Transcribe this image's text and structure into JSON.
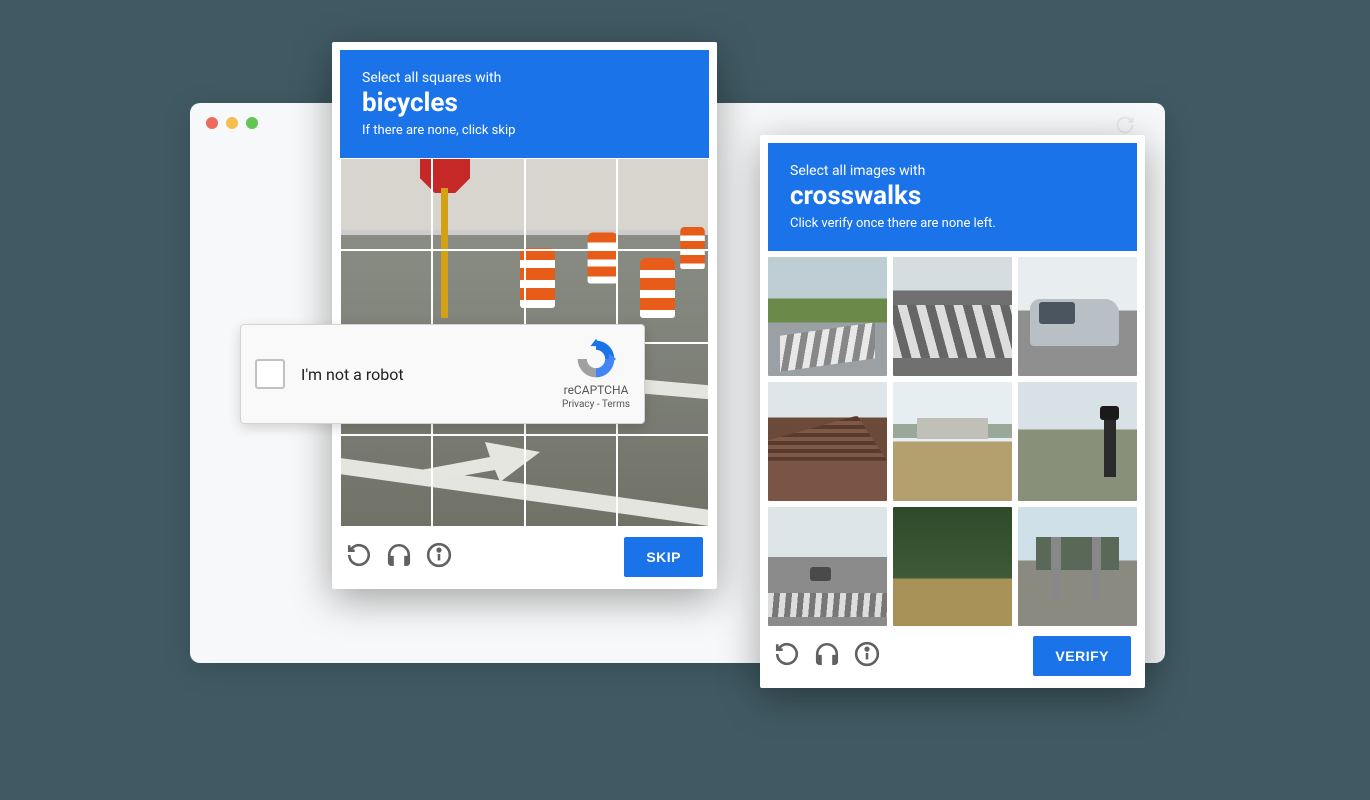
{
  "captcha_left": {
    "prompt_line1": "Select all squares with",
    "subject": "bicycles",
    "prompt_line3": "If there are none, click skip",
    "button_label": "SKIP",
    "grid_cells": 16
  },
  "captcha_right": {
    "prompt_line1": "Select all images with",
    "subject": "crosswalks",
    "prompt_line3": "Click verify once there are none left.",
    "button_label": "VERIFY",
    "grid_cells": 9
  },
  "recaptcha_widget": {
    "label": "I'm not a robot",
    "brand": "reCAPTCHA",
    "privacy": "Privacy",
    "terms": "Terms",
    "separator": " - "
  },
  "icons": {
    "reload": "reload-icon",
    "headphones": "headphones-icon",
    "info": "info-icon"
  }
}
